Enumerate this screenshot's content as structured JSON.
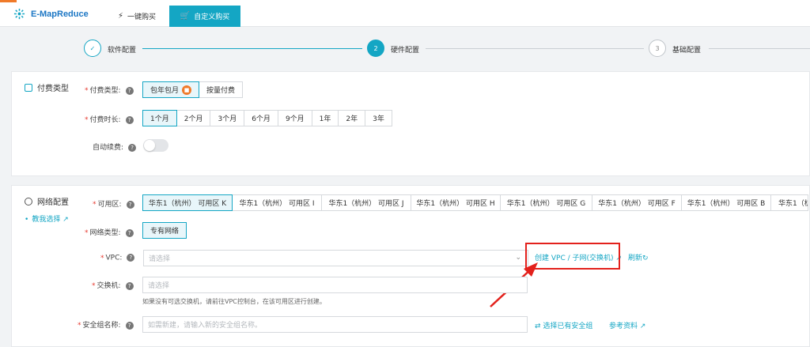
{
  "topbar": {
    "brand": "E-MapReduce",
    "tabs": [
      {
        "label": "一键购买",
        "icon": "bolt-icon"
      },
      {
        "label": "自定义购买",
        "icon": "cart-icon"
      }
    ]
  },
  "steps": [
    {
      "label": "软件配置",
      "symbol": "✓"
    },
    {
      "label": "硬件配置",
      "symbol": "2"
    },
    {
      "label": "基础配置",
      "symbol": "3"
    }
  ],
  "billing": {
    "title": "付费类型",
    "pay_type_label": "付费类型:",
    "pay_options": [
      "包年包月",
      "按量付费"
    ],
    "duration_label": "付费时长:",
    "durations": [
      "1个月",
      "2个月",
      "3个月",
      "6个月",
      "9个月",
      "1年",
      "2年",
      "3年"
    ],
    "auto_renew_label": "自动续费:"
  },
  "network": {
    "title": "网络配置",
    "help_link": "教我选择",
    "zone_label": "可用区:",
    "zones": [
      "华东1（杭州） 可用区 K",
      "华东1（杭州） 可用区 I",
      "华东1（杭州） 可用区 J",
      "华东1（杭州） 可用区 H",
      "华东1（杭州） 可用区 G",
      "华东1（杭州） 可用区 F",
      "华东1（杭州） 可用区 B",
      "华东1（杭"
    ],
    "net_type_label": "网络类型:",
    "net_type": "专有网络",
    "vpc_label": "VPC:",
    "vpc_placeholder": "请选择",
    "create_vpc_link": "创建 VPC / 子网(交换机)",
    "refresh_link": "刷新",
    "switch_label": "交换机:",
    "switch_placeholder": "请选择",
    "switch_hint": "如果没有可选交换机，请前往VPC控制台，在该可用区进行创建。",
    "sg_label": "安全组名称:",
    "sg_placeholder": "如需新建，请输入新的安全组名称。",
    "select_sg_link": "选择已有安全组",
    "reference_link": "参考资料"
  },
  "colors": {
    "accent": "#14a6c4",
    "brand": "#1b76c4",
    "annotation": "#e3211c",
    "badge": "#f07a29"
  }
}
